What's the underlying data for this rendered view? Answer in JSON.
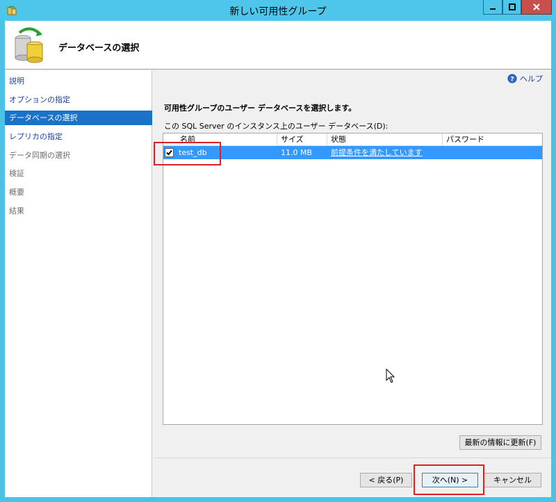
{
  "window": {
    "title": "新しい可用性グループ"
  },
  "header": {
    "title": "データベースの選択"
  },
  "sidebar": {
    "items": [
      {
        "label": "説明",
        "state": "normal"
      },
      {
        "label": "オプションの指定",
        "state": "normal"
      },
      {
        "label": "データベースの選択",
        "state": "active"
      },
      {
        "label": "レプリカの指定",
        "state": "normal"
      },
      {
        "label": "データ同期の選択",
        "state": "disabled"
      },
      {
        "label": "検証",
        "state": "disabled"
      },
      {
        "label": "概要",
        "state": "disabled"
      },
      {
        "label": "結果",
        "state": "disabled"
      }
    ]
  },
  "help": {
    "label": "ヘルプ",
    "icon": "help-icon"
  },
  "main": {
    "heading": "可用性グループのユーザー データベースを選択します。",
    "list_label": "この SQL Server のインスタンス上のユーザー データベース(D):",
    "columns": [
      "名前",
      "サイズ",
      "状態",
      "パスワード"
    ],
    "rows": [
      {
        "checked": true,
        "name": "test_db",
        "size": "11.0 MB",
        "status": "前提条件を満たしています",
        "password": ""
      }
    ]
  },
  "buttons": {
    "refresh": "最新の情報に更新(F)",
    "back": "< 戻る(P)",
    "next": "次へ(N) >",
    "cancel": "キャンセル"
  },
  "colors": {
    "titlebar": "#4ec5ea",
    "selection": "#3399ff",
    "nav_active": "#1a73c8",
    "link": "#1a3fa0",
    "highlight": "#e02020"
  }
}
